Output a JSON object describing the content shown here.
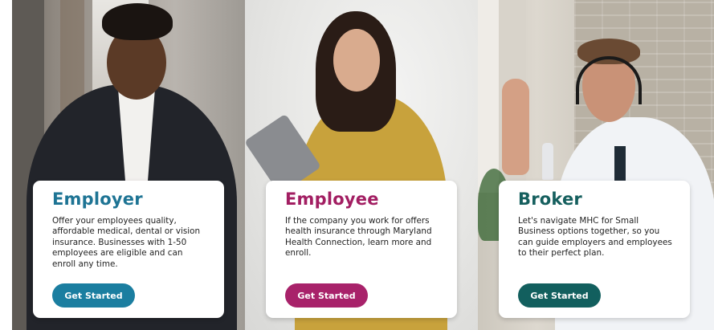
{
  "cards": [
    {
      "id": "employer",
      "title": "Employer",
      "description": "Offer your employees quality, affordable medical, dental or vision insurance. Businesses with 1-50 employees are eligible and can enroll any time.",
      "button_label": "Get Started",
      "accent_color": "#1b7ea0"
    },
    {
      "id": "employee",
      "title": "Employee",
      "description": "If the company you work for offers health insurance through Maryland Health Connection, learn more and enroll.",
      "button_label": "Get Started",
      "accent_color": "#a8226a"
    },
    {
      "id": "broker",
      "title": "Broker",
      "description": "Let's navigate MHC for Small Business options together, so you can guide employers and employees to their perfect plan.",
      "button_label": "Get Started",
      "accent_color": "#125f5e"
    }
  ],
  "images": {
    "employer": "smiling man in dark suit jacket and white shirt",
    "employee": "woman with glasses and mustard shirt holding a tablet",
    "broker": "man with headset in white shirt and tie, hand raised"
  }
}
